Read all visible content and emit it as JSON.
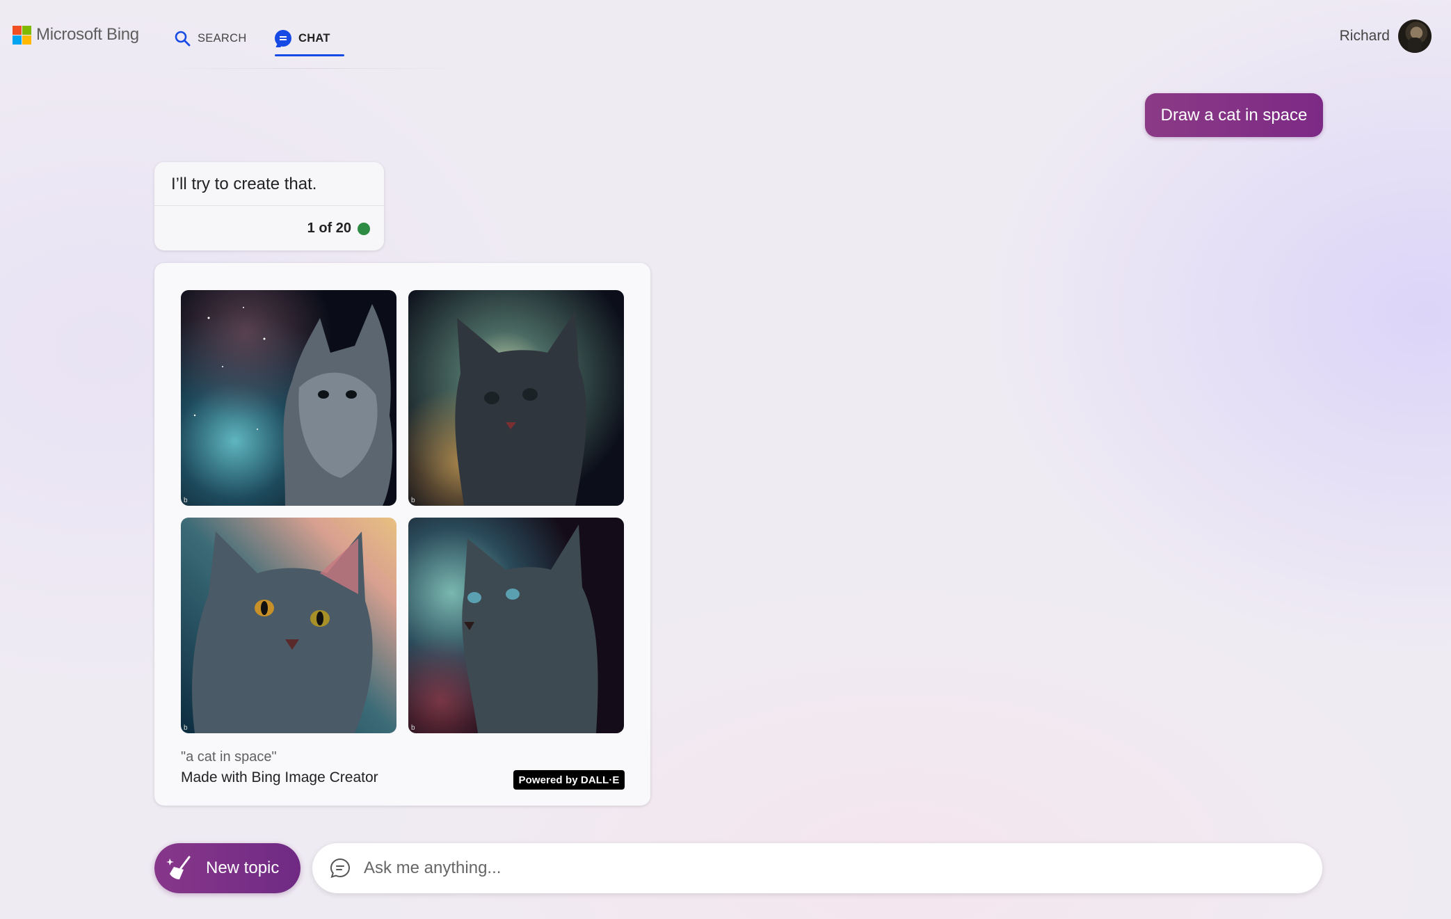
{
  "header": {
    "logo_text": "Microsoft Bing",
    "nav": {
      "search_label": "SEARCH",
      "chat_label": "CHAT"
    },
    "user_name": "Richard"
  },
  "conversation": {
    "user_message": "Draw a cat in space",
    "bot_message": "I’ll try to create that.",
    "turn_counter": "1 of 20",
    "image_result": {
      "prompt": "\"a cat in space\"",
      "caption": "Made with Bing Image Creator",
      "badge": "Powered by DALL·E",
      "watermark": "b",
      "image_count": 4
    }
  },
  "composer": {
    "new_topic_label": "New topic",
    "input_placeholder": "Ask me anything..."
  },
  "colors": {
    "accent_purple": "#8b3a86",
    "chat_blue": "#174ae4",
    "status_green": "#2e8b43"
  }
}
